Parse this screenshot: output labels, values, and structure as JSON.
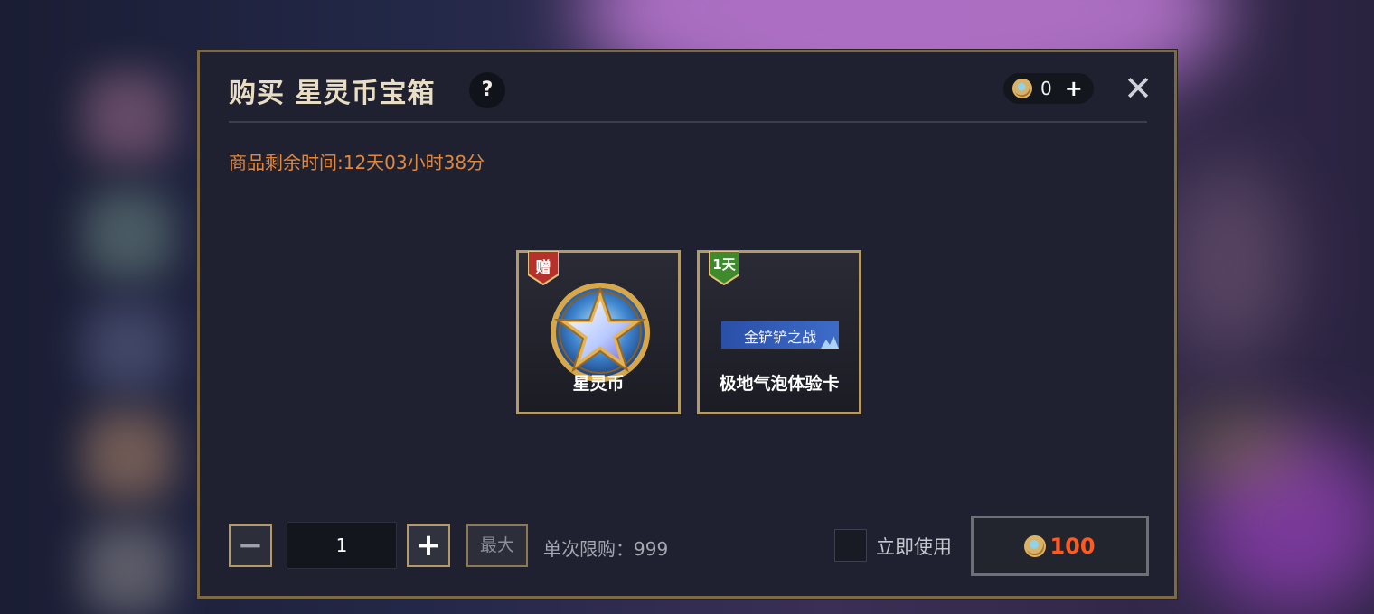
{
  "dialog": {
    "title": "购买 星灵币宝箱",
    "help_label": "?",
    "currency": {
      "icon": "star-coin-icon",
      "amount": "0",
      "add_label": "+"
    },
    "close_label": "✕",
    "timer_text": "商品剩余时间:12天03小时38分"
  },
  "items": [
    {
      "badge": "赠",
      "badge_color": "#b5322b",
      "icon": "star-coin-icon",
      "name": "星灵币"
    },
    {
      "badge": "1天",
      "badge_color": "#3f8a2c",
      "icon": "banner-icon",
      "banner_text": "金铲铲之战",
      "name": "极地气泡体验卡"
    }
  ],
  "purchase": {
    "minus_label": "−",
    "quantity": "1",
    "plus_label": "+",
    "max_label": "最大",
    "limit_text": "单次限购：999",
    "use_now_label": "立即使用",
    "use_now_checked": false,
    "price": "100"
  },
  "colors": {
    "accent_gold": "#b49a66",
    "timer_orange": "#e0883f",
    "price_red": "#ff5a22"
  }
}
